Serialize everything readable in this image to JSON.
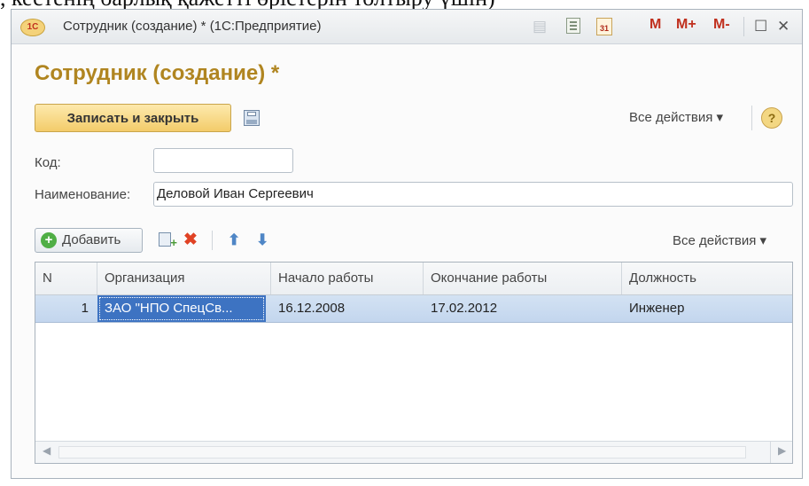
{
  "top_caption": ", кестенің барлық қажетті өрістерін толтыру үшін)",
  "window": {
    "title": "Сотрудник (создание) * (1С:Предприятие)",
    "logo_text": "1С",
    "toolbar": {
      "m_label": "M",
      "mplus_label": "M+",
      "mminus_label": "M-",
      "calendar_text": "31",
      "maximize_glyph": "☐",
      "close_glyph": "✕"
    }
  },
  "form": {
    "title": "Сотрудник (создание) *",
    "save_close_label": "Записать и закрыть",
    "all_actions_label": "Все действия ▾",
    "help_glyph": "?",
    "code_label": "Код:",
    "code_value": "",
    "name_label": "Наименование:",
    "name_value": "Деловой Иван Сергеевич"
  },
  "table_toolbar": {
    "add_label": "Добавить",
    "all_actions_label": "Все действия ▾"
  },
  "table": {
    "columns": [
      "N",
      "Организация",
      "Начало работы",
      "Окончание работы",
      "Должность"
    ],
    "rows": [
      {
        "n": "1",
        "org": "ЗАО \"НПО СпецСв...",
        "start": "16.12.2008",
        "end": "17.02.2012",
        "position": "Инженер"
      }
    ]
  },
  "icons": {
    "toolbar": [
      "document-icon",
      "calculator-icon",
      "calendar-icon",
      "maximize-icon",
      "close-icon"
    ],
    "form": [
      "save-floppy-icon",
      "help-icon",
      "add-icon",
      "copy-icon",
      "delete-icon",
      "move-up-icon",
      "move-down-icon"
    ]
  },
  "colors": {
    "title_accent": "#b08520",
    "primary_button": "#f3cc6a",
    "selection_row": "#c3d6ee",
    "selection_cell": "#3d73c2",
    "delete": "#e04224",
    "arrows": "#4f86c6",
    "add": "#4fae45"
  }
}
